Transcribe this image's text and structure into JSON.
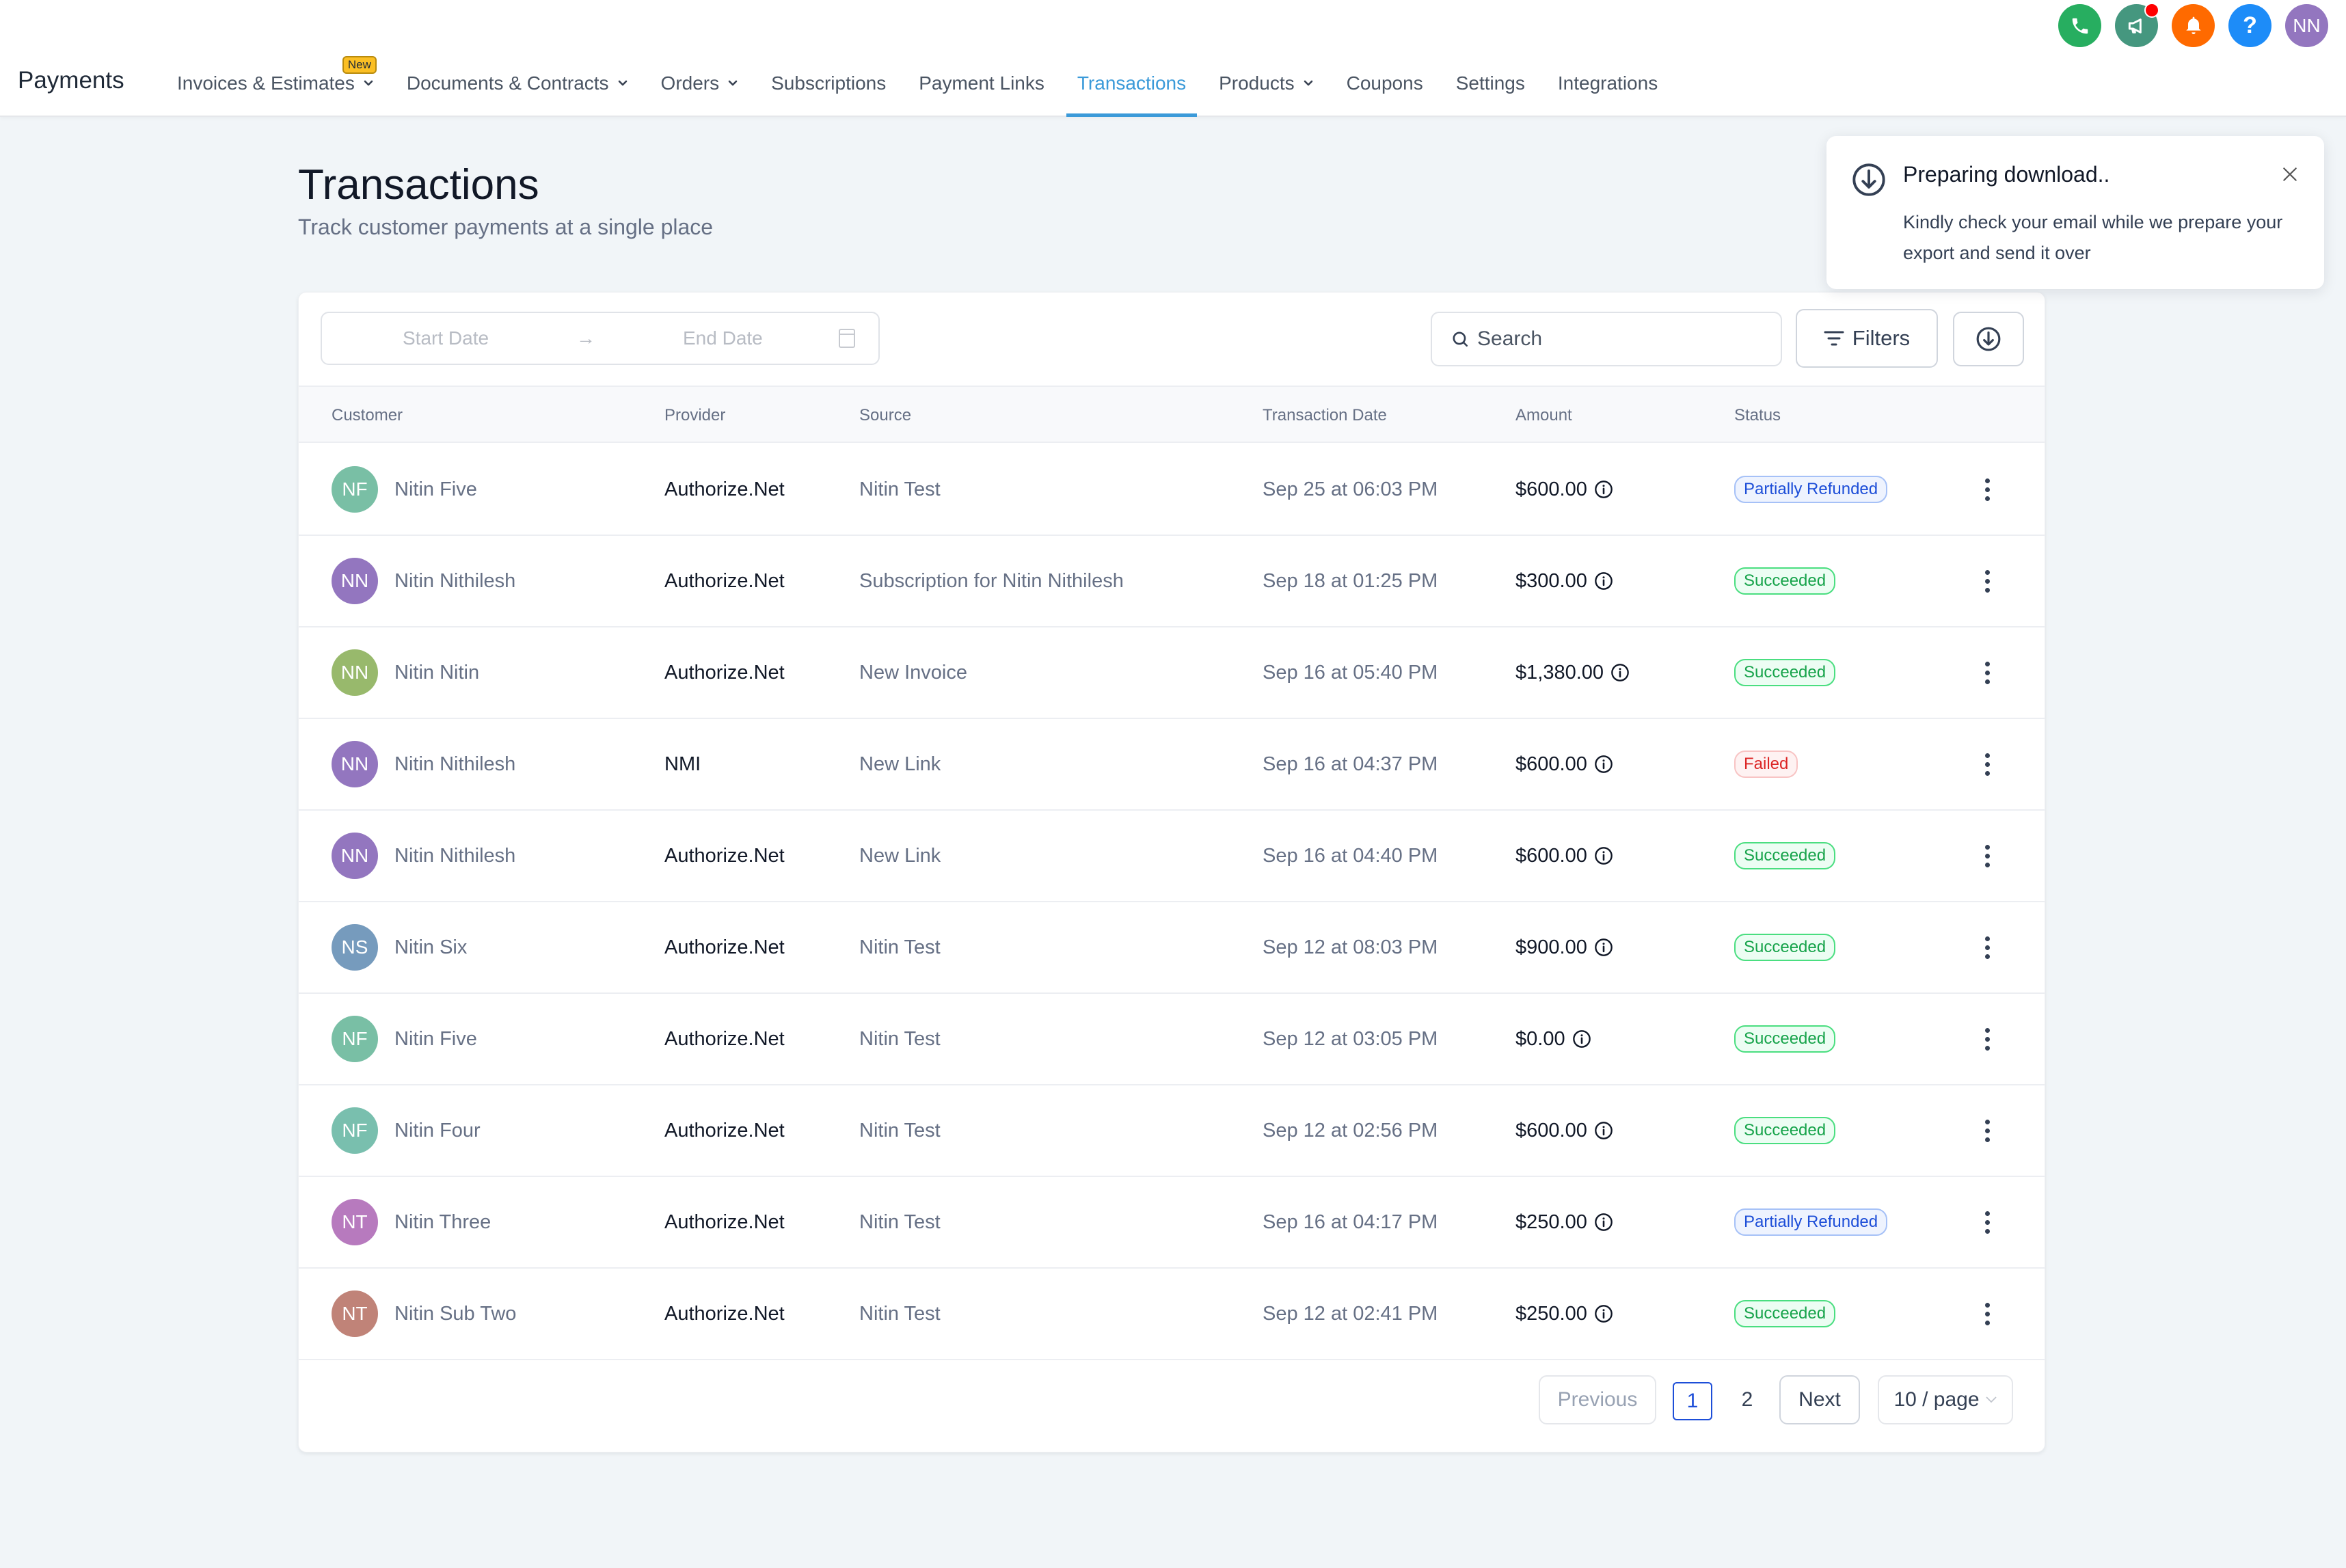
{
  "header": {
    "app_title": "Payments",
    "nav": [
      {
        "label": "Invoices & Estimates",
        "dropdown": true,
        "badge": "New"
      },
      {
        "label": "Documents & Contracts",
        "dropdown": true
      },
      {
        "label": "Orders",
        "dropdown": true
      },
      {
        "label": "Subscriptions"
      },
      {
        "label": "Payment Links"
      },
      {
        "label": "Transactions",
        "active": true
      },
      {
        "label": "Products",
        "dropdown": true
      },
      {
        "label": "Coupons"
      },
      {
        "label": "Settings"
      },
      {
        "label": "Integrations"
      }
    ],
    "top_icons": {
      "phone": "phone-icon",
      "announcements": "megaphone-icon",
      "notifications": "bell-icon",
      "help": "?",
      "user_initials": "NN"
    },
    "colors": {
      "phone": "#27ae60",
      "announcements": "#45977f",
      "notifications": "#ff6a00",
      "help": "#1d8cf8",
      "user": "#9376bf",
      "active_tab": "#3b9ad9"
    }
  },
  "page": {
    "title": "Transactions",
    "subtitle": "Track customer payments at a single place"
  },
  "toolbar": {
    "start_date_placeholder": "Start Date",
    "end_date_placeholder": "End Date",
    "search_placeholder": "Search",
    "filters_label": "Filters"
  },
  "table": {
    "columns": [
      "Customer",
      "Provider",
      "Source",
      "Transaction Date",
      "Amount",
      "Status"
    ],
    "rows": [
      {
        "initials": "NF",
        "avatar_color": "#79bfa5",
        "customer": "Nitin Five",
        "provider": "Authorize.Net",
        "source": "Nitin Test",
        "date": "Sep 25 at 06:03 PM",
        "amount": "$600.00",
        "status": "Partially Refunded",
        "status_key": "partially-refunded"
      },
      {
        "initials": "NN",
        "avatar_color": "#9376bf",
        "customer": "Nitin Nithilesh",
        "provider": "Authorize.Net",
        "source": "Subscription for Nitin Nithilesh",
        "date": "Sep 18 at 01:25 PM",
        "amount": "$300.00",
        "status": "Succeeded",
        "status_key": "succeeded"
      },
      {
        "initials": "NN",
        "avatar_color": "#98b96c",
        "customer": "Nitin Nitin",
        "provider": "Authorize.Net",
        "source": "New Invoice",
        "date": "Sep 16 at 05:40 PM",
        "amount": "$1,380.00",
        "status": "Succeeded",
        "status_key": "succeeded"
      },
      {
        "initials": "NN",
        "avatar_color": "#9376bf",
        "customer": "Nitin Nithilesh",
        "provider": "NMI",
        "source": "New Link",
        "date": "Sep 16 at 04:37 PM",
        "amount": "$600.00",
        "status": "Failed",
        "status_key": "failed"
      },
      {
        "initials": "NN",
        "avatar_color": "#9376bf",
        "customer": "Nitin Nithilesh",
        "provider": "Authorize.Net",
        "source": "New Link",
        "date": "Sep 16 at 04:40 PM",
        "amount": "$600.00",
        "status": "Succeeded",
        "status_key": "succeeded"
      },
      {
        "initials": "NS",
        "avatar_color": "#769bbd",
        "customer": "Nitin Six",
        "provider": "Authorize.Net",
        "source": "Nitin Test",
        "date": "Sep 12 at 08:03 PM",
        "amount": "$900.00",
        "status": "Succeeded",
        "status_key": "succeeded"
      },
      {
        "initials": "NF",
        "avatar_color": "#79bfa5",
        "customer": "Nitin Five",
        "provider": "Authorize.Net",
        "source": "Nitin Test",
        "date": "Sep 12 at 03:05 PM",
        "amount": "$0.00",
        "status": "Succeeded",
        "status_key": "succeeded"
      },
      {
        "initials": "NF",
        "avatar_color": "#79bfae",
        "customer": "Nitin Four",
        "provider": "Authorize.Net",
        "source": "Nitin Test",
        "date": "Sep 12 at 02:56 PM",
        "amount": "$600.00",
        "status": "Succeeded",
        "status_key": "succeeded"
      },
      {
        "initials": "NT",
        "avatar_color": "#b77abe",
        "customer": "Nitin Three",
        "provider": "Authorize.Net",
        "source": "Nitin Test",
        "date": "Sep 16 at 04:17 PM",
        "amount": "$250.00",
        "status": "Partially Refunded",
        "status_key": "partially-refunded"
      },
      {
        "initials": "NT",
        "avatar_color": "#c08378",
        "customer": "Nitin Sub Two",
        "provider": "Authorize.Net",
        "source": "Nitin Test",
        "date": "Sep 12 at 02:41 PM",
        "amount": "$250.00",
        "status": "Succeeded",
        "status_key": "succeeded"
      }
    ]
  },
  "pagination": {
    "previous_label": "Previous",
    "pages": [
      "1",
      "2"
    ],
    "current_page": "1",
    "next_label": "Next",
    "page_size_label": "10 / page"
  },
  "toast": {
    "title": "Preparing download..",
    "body": "Kindly check your email while we prepare your export and send it over"
  }
}
